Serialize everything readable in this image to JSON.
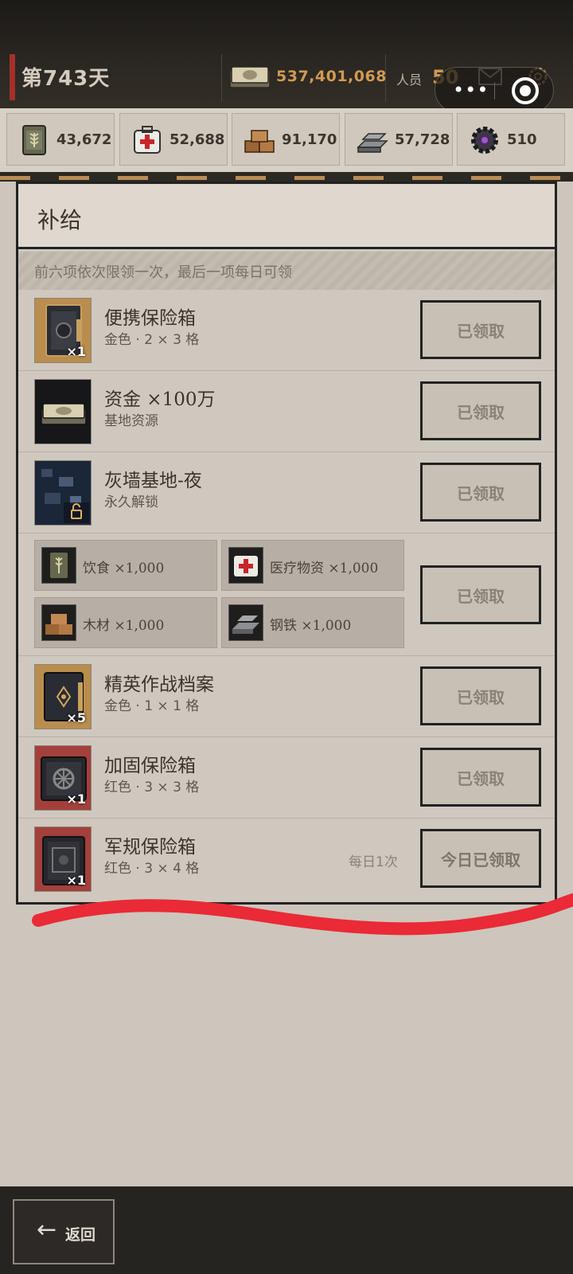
{
  "header": {
    "day": "第743天",
    "money": "537,401,068",
    "people_label": "人员",
    "people_value": "50"
  },
  "resources": [
    {
      "name": "food-icon",
      "value": "43,672"
    },
    {
      "name": "medical-icon",
      "value": "52,688"
    },
    {
      "name": "wood-icon",
      "value": "91,170"
    },
    {
      "name": "steel-icon",
      "value": "57,728"
    },
    {
      "name": "gear-part-icon",
      "value": "510"
    }
  ],
  "panel": {
    "title": "补给",
    "notice": "前六项依次限领一次，最后一项每日可领"
  },
  "items": [
    {
      "name": "便携保险箱",
      "sub": "金色 · 2 × 3 格",
      "qty": "×1",
      "button": "已领取"
    },
    {
      "name": "资金 ×100万",
      "sub": "基地资源",
      "qty": "",
      "button": "已领取"
    },
    {
      "name": "灰墙基地-夜",
      "sub": "永久解锁",
      "qty": "",
      "button": "已领取"
    },
    {
      "name": "精英作战档案",
      "sub": "金色 · 1 × 1 格",
      "qty": "×5",
      "button": "已领取"
    },
    {
      "name": "加固保险箱",
      "sub": "红色 · 3 × 3 格",
      "qty": "×1",
      "button": "已领取"
    },
    {
      "name": "军规保险箱",
      "sub": "红色 · 3 × 4 格",
      "qty": "×1",
      "button": "今日已领取",
      "daily": "每日1次"
    }
  ],
  "bundle": {
    "tiles": [
      {
        "label": "饮食 ×1,000",
        "icon": "food-icon"
      },
      {
        "label": "医疗物资 ×1,000",
        "icon": "medical-icon"
      },
      {
        "label": "木材 ×1,000",
        "icon": "wood-icon"
      },
      {
        "label": "钢铁 ×1,000",
        "icon": "steel-icon"
      }
    ],
    "button": "已领取"
  },
  "footer": {
    "back_label": "返回"
  },
  "colors": {
    "accent_gold": "#d19a52",
    "day_accent": "#a5302a",
    "scribble_red": "#ea2a36"
  }
}
